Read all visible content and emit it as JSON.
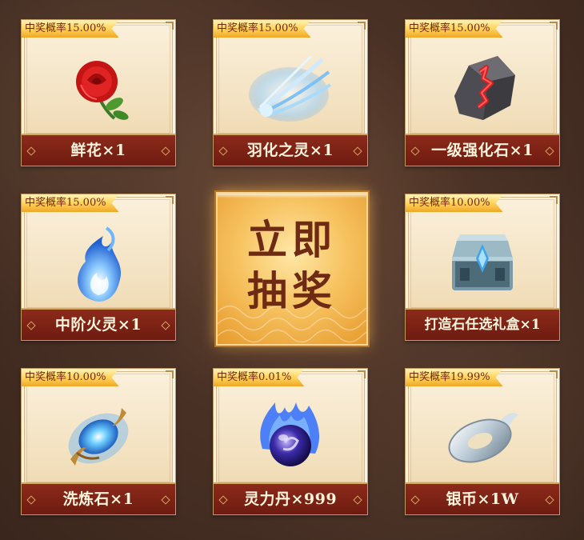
{
  "draw_button": {
    "line1": "立即",
    "line2": "抽奖"
  },
  "prizes": [
    {
      "rate": "中奖概率15.00%",
      "name": "鲜花×1",
      "icon": "rose-icon"
    },
    {
      "rate": "中奖概率15.00%",
      "name": "羽化之灵×1",
      "icon": "feather-spirit-icon"
    },
    {
      "rate": "中奖概率15.00%",
      "name": "一级强化石×1",
      "icon": "enhance-stone-icon"
    },
    {
      "rate": "中奖概率15.00%",
      "name": "中阶火灵×1",
      "icon": "blue-flame-icon"
    },
    {
      "rate": "中奖概率10.00%",
      "name": "打造石任选礼盒×1",
      "icon": "treasure-chest-icon"
    },
    {
      "rate": "中奖概率10.00%",
      "name": "洗炼石×1",
      "icon": "refine-gem-icon"
    },
    {
      "rate": "中奖概率0.01%",
      "name": "灵力丹×999",
      "icon": "spirit-pill-icon"
    },
    {
      "rate": "中奖概率19.99%",
      "name": "银币×1W",
      "icon": "silver-coin-icon"
    }
  ],
  "colors": {
    "accent_red": "#7a1f12",
    "badge_gold": "#ffd45a",
    "card_cream": "#f6e6c5",
    "draw_gold": "#f7c463"
  }
}
